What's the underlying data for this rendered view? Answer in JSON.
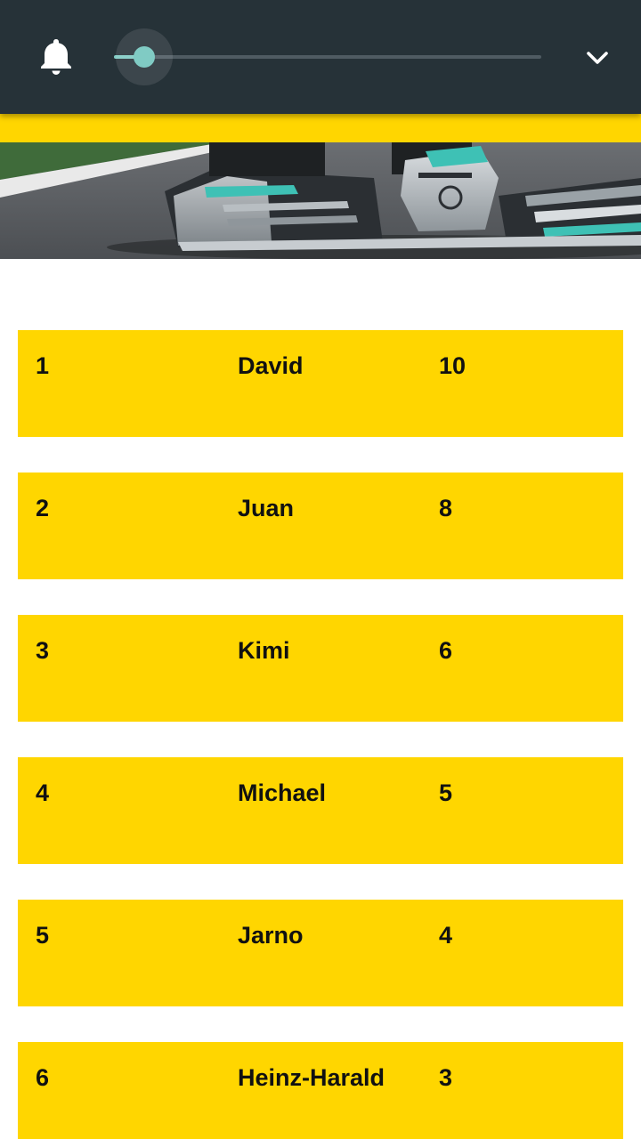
{
  "toolbar": {
    "bell_icon": "bell-icon",
    "expand_icon": "chevron-down-icon",
    "slider": {
      "value_fraction": 0.07
    },
    "colors": {
      "bar": "#263238",
      "accent": "#80cbc4",
      "highlight": "#ffd600"
    }
  },
  "hero": {
    "image": "mercedes-f1-front-wing-photo"
  },
  "standings": [
    {
      "position": "1",
      "driver": "David",
      "points": "10"
    },
    {
      "position": "2",
      "driver": "Juan",
      "points": "8"
    },
    {
      "position": "3",
      "driver": "Kimi",
      "points": "6"
    },
    {
      "position": "4",
      "driver": "Michael",
      "points": "5"
    },
    {
      "position": "5",
      "driver": "Jarno",
      "points": "4"
    },
    {
      "position": "6",
      "driver": "Heinz-Harald",
      "points": "3"
    }
  ]
}
